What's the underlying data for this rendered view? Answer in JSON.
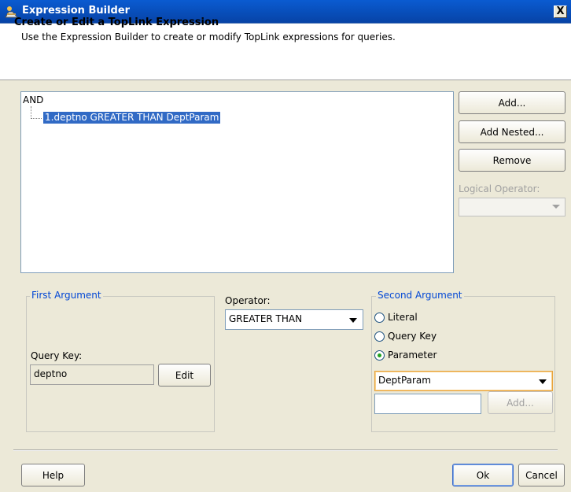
{
  "window": {
    "title": "Expression Builder",
    "close_glyph": "X"
  },
  "header": {
    "title": "Create or Edit a TopLink Expression",
    "description": "Use the Expression Builder to create or modify TopLink expressions for queries."
  },
  "tree": {
    "root": "AND",
    "node": "1.deptno GREATER THAN DeptParam"
  },
  "side_buttons": {
    "add": "Add...",
    "add_nested": "Add Nested...",
    "remove": "Remove",
    "logical_operator_label": "Logical Operator:",
    "logical_operator_value": ""
  },
  "first_argument": {
    "legend": "First Argument",
    "query_key_label": "Query Key:",
    "query_key_value": "deptno",
    "edit": "Edit"
  },
  "operator": {
    "label": "Operator:",
    "value": "GREATER THAN"
  },
  "second_argument": {
    "legend": "Second Argument",
    "options": [
      "Literal",
      "Query Key",
      "Parameter"
    ],
    "selected": "Parameter",
    "parameter_value": "DeptParam",
    "input_value": "",
    "add": "Add..."
  },
  "footer": {
    "help": "Help",
    "ok": "Ok",
    "cancel": "Cancel"
  },
  "colors": {
    "title_bar": "#0a5bd1",
    "selection": "#316ac5",
    "group_legend": "#0046d5",
    "dialog_bg": "#ece9d8"
  }
}
